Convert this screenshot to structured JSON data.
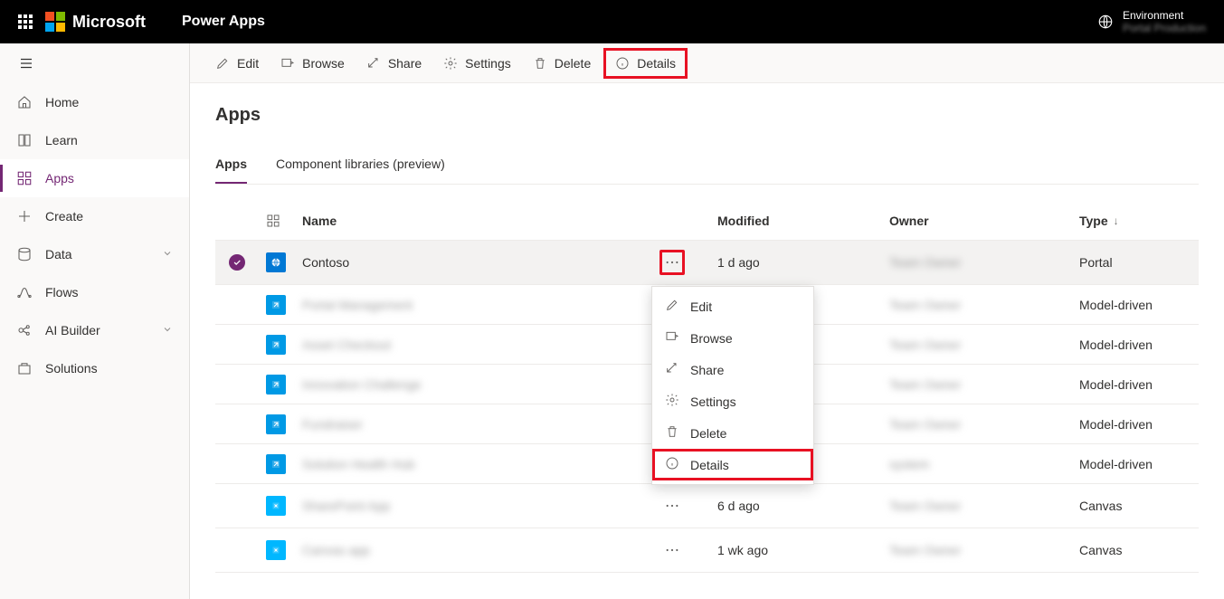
{
  "header": {
    "brand": "Microsoft",
    "product": "Power Apps",
    "environment_label": "Environment",
    "environment_name": "Portal Production"
  },
  "sidebar": {
    "items": [
      {
        "icon": "home",
        "label": "Home"
      },
      {
        "icon": "book",
        "label": "Learn"
      },
      {
        "icon": "apps",
        "label": "Apps",
        "active": true
      },
      {
        "icon": "plus",
        "label": "Create"
      },
      {
        "icon": "data",
        "label": "Data",
        "chevron": true
      },
      {
        "icon": "flow",
        "label": "Flows"
      },
      {
        "icon": "ai",
        "label": "AI Builder",
        "chevron": true
      },
      {
        "icon": "solutions",
        "label": "Solutions"
      }
    ]
  },
  "commandbar": {
    "edit": "Edit",
    "browse": "Browse",
    "share": "Share",
    "settings": "Settings",
    "delete": "Delete",
    "details": "Details"
  },
  "page": {
    "title": "Apps",
    "tabs": [
      "Apps",
      "Component libraries (preview)"
    ],
    "active_tab": 0
  },
  "columns": {
    "name": "Name",
    "modified": "Modified",
    "owner": "Owner",
    "type": "Type"
  },
  "rows": [
    {
      "selected": true,
      "icon": "portal",
      "name": "Contoso",
      "modified": "1 d ago",
      "owner": "Team Owner",
      "type": "Portal",
      "blurname": false,
      "hl_more": true
    },
    {
      "icon": "model",
      "name": "Portal Management",
      "modified": "",
      "owner": "Team Owner",
      "type": "Model-driven",
      "blurname": true
    },
    {
      "icon": "model",
      "name": "Asset Checkout",
      "modified": "",
      "owner": "Team Owner",
      "type": "Model-driven",
      "blurname": true
    },
    {
      "icon": "model",
      "name": "Innovation Challenge",
      "modified": "",
      "owner": "Team Owner",
      "type": "Model-driven",
      "blurname": true
    },
    {
      "icon": "model",
      "name": "Fundraiser",
      "modified": "",
      "owner": "Team Owner",
      "type": "Model-driven",
      "blurname": true
    },
    {
      "icon": "model",
      "name": "Solution Health Hub",
      "modified": "",
      "owner": "system",
      "type": "Model-driven",
      "blurname": true
    },
    {
      "icon": "canvas",
      "name": "SharePoint App",
      "modified": "6 d ago",
      "owner": "Team Owner",
      "type": "Canvas",
      "blurname": true,
      "show_more": true
    },
    {
      "icon": "canvas",
      "name": "Canvas app",
      "modified": "1 wk ago",
      "owner": "Team Owner",
      "type": "Canvas",
      "blurname": true,
      "show_more": true
    }
  ],
  "context_menu": {
    "items": [
      {
        "icon": "edit",
        "label": "Edit"
      },
      {
        "icon": "browse",
        "label": "Browse"
      },
      {
        "icon": "share",
        "label": "Share"
      },
      {
        "icon": "settings",
        "label": "Settings"
      },
      {
        "icon": "delete",
        "label": "Delete"
      },
      {
        "icon": "details",
        "label": "Details",
        "highlight": true
      }
    ]
  }
}
